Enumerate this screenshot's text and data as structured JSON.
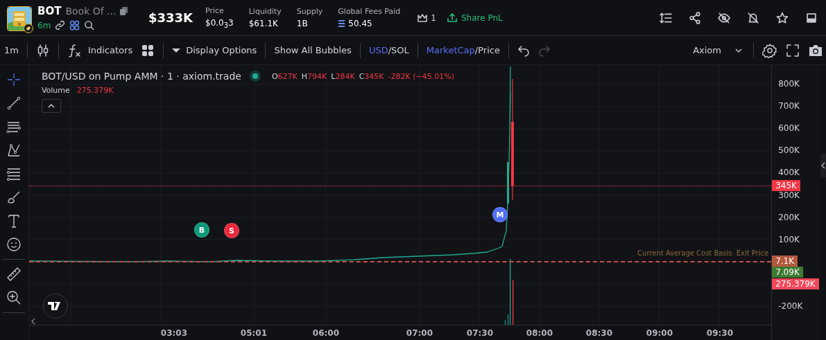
{
  "token": {
    "symbol": "BOT",
    "name": "Book Of ...",
    "age": "6m",
    "market_cap": "$333K"
  },
  "stats": [
    {
      "label": "Price",
      "value": "$0.0$_{3}$3"
    },
    {
      "label": "Liquidity",
      "value": "$61.1K"
    },
    {
      "label": "Supply",
      "value": "1B"
    },
    {
      "label": "Global Fees Paid",
      "value": "50.45",
      "kind": "sol"
    }
  ],
  "holders_count": "1",
  "share_button": "Share PnL",
  "toolbar": {
    "interval": "1m",
    "indicators": "Indicators",
    "display_options": "Display Options",
    "bubbles": "Show All Bubbles",
    "currency": {
      "separator": "/",
      "options": [
        {
          "label": "USD",
          "selected": true
        },
        {
          "label": "SOL",
          "selected": false
        }
      ]
    },
    "metric": {
      "separator": "/",
      "options": [
        {
          "label": "MarketCap",
          "selected": true
        },
        {
          "label": "Price",
          "selected": false
        }
      ]
    },
    "undo_disabled": false,
    "redo_disabled": true,
    "theme": "Axiom"
  },
  "tools": [
    {
      "selected": true
    },
    {
      "selected": false
    },
    {
      "selected": false
    },
    {
      "selected": false
    },
    {
      "selected": false
    },
    {
      "selected": false
    },
    {
      "selected": false
    },
    {
      "selected": false
    },
    {
      "selected": false
    },
    {
      "selected": false
    }
  ],
  "legend": {
    "title": "BOT/USD on Pump AMM · 1 · axiom.trade",
    "ohlc": [
      {
        "key": "O",
        "value": "627K"
      },
      {
        "key": "H",
        "value": "794K"
      },
      {
        "key": "L",
        "value": "284K"
      },
      {
        "key": "C",
        "value": "345K"
      }
    ],
    "change": "-282K (−45.01%)",
    "volume_label": "Volume",
    "volume_value": "275.379K"
  },
  "markers": [
    {
      "label": "B",
      "color": "#0e9a7a"
    },
    {
      "label": "S",
      "color": "#e8283c"
    },
    {
      "label": "M",
      "color": "#4f6ef7"
    }
  ],
  "line_labels": [
    "Current Average Cost Basis",
    "Exit Price"
  ],
  "y_ticks": [
    "800K",
    "700K",
    "600K",
    "500K",
    "400K",
    "300K",
    "200K",
    "100K",
    "-200K"
  ],
  "price_tags": [
    {
      "value": "345K",
      "color": "#f23645"
    },
    {
      "value": "7.1K",
      "color": "#b5583e"
    },
    {
      "value": "7.09K",
      "color": "#3d7a32"
    },
    {
      "value": "275.379K",
      "color": "#f0475a"
    }
  ],
  "x_ticks": [
    "03:03",
    "05:01",
    "06:00",
    "07:00",
    "07:30",
    "08:00",
    "08:30",
    "09:00",
    "09:30"
  ]
}
